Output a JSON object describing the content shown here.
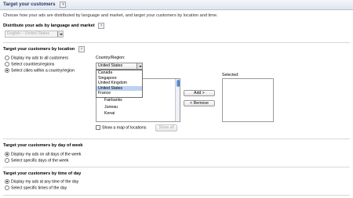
{
  "header": {
    "title": "Target your customers",
    "help": "?"
  },
  "intro": "Choose how your ads are distributed by language and market, and target your customers by location and time.",
  "language_section": {
    "title": "Distribute your ads by language and market",
    "help": "?",
    "select_value": "English – United States"
  },
  "location_section": {
    "title": "Target your customers by location",
    "help": "?",
    "options": [
      {
        "label": "Display my ads to all customers",
        "selected": false
      },
      {
        "label": "Select countries/regions",
        "selected": false
      },
      {
        "label": "Select cities within a country/region",
        "selected": true
      }
    ],
    "country_label": "Country/Region:",
    "country_value": "United States",
    "country_options": [
      "Canada",
      "Singapore",
      "United Kingdom",
      "United States",
      "France"
    ],
    "highlighted_option": "United States",
    "available_label": "A",
    "cities": [
      "Fairbanks",
      "Juneau",
      "Kenai"
    ],
    "add_button": "Add >",
    "remove_button": "< Remove",
    "selected_label": "Selected:",
    "map_checkbox_label": "Show a map of locations",
    "show_all_button": "Show all"
  },
  "day_section": {
    "title": "Target your customers by day of week",
    "options": [
      {
        "label": "Display my ads on all days of the week",
        "selected": true
      },
      {
        "label": "Select specific days of the week",
        "selected": false
      }
    ]
  },
  "time_section": {
    "title": "Target your customers by time of day",
    "options": [
      {
        "label": "Display my ads at any time of the day",
        "selected": true
      },
      {
        "label": "Select specific times of the day",
        "selected": false
      }
    ]
  }
}
